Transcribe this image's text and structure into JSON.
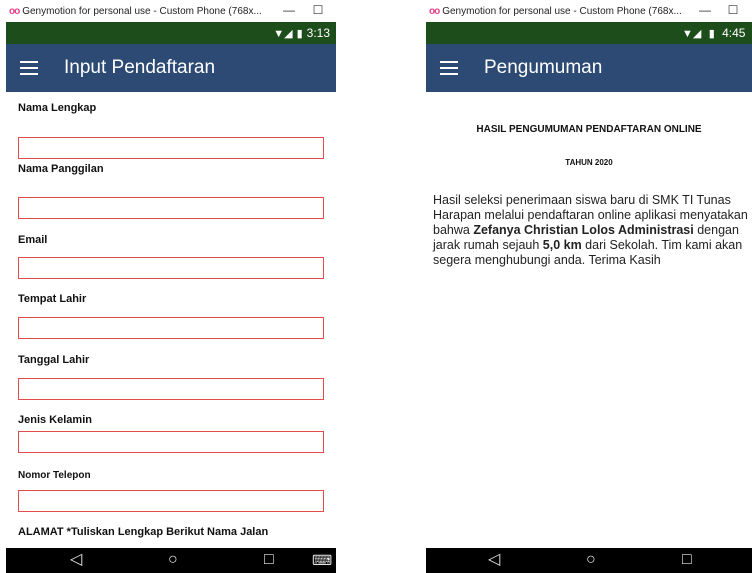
{
  "left": {
    "window_title": "Genymotion for personal use - Custom Phone (768x...",
    "logo": "oo",
    "minimize": "—",
    "maximize": "☐",
    "time": "3:13",
    "app_title": "Input Pendaftaran",
    "fields": [
      {
        "label": "Nama Lengkap"
      },
      {
        "label": "Nama Panggilan"
      },
      {
        "label": "Email"
      },
      {
        "label": "Tempat Lahir"
      },
      {
        "label": "Tanggal Lahir"
      },
      {
        "label": "Jenis Kelamin"
      },
      {
        "label": "Nomor Telepon"
      },
      {
        "label": "ALAMAT *Tuliskan Lengkap Berikut Nama Jalan"
      }
    ],
    "nav": {
      "back": "◁",
      "home": "○",
      "recent": "□",
      "keyboard": "⌨"
    }
  },
  "right": {
    "window_title": "Genymotion for personal use - Custom Phone (768x...",
    "logo": "oo",
    "minimize": "—",
    "maximize": "☐",
    "time": "4:45",
    "app_title": "Pengumuman",
    "heading": "HASIL PENGUMUMAN PENDAFTARAN ONLINE",
    "year": "TAHUN 2020",
    "body": {
      "part1": "Hasil seleksi penerimaan siswa baru di SMK TI Tunas Harapan melalui pendaftaran online aplikasi menyatakan bahwa ",
      "name": "Zefanya Christian Lolos Administrasi",
      "part2": " dengan jarak rumah sejauh ",
      "distance": "5,0 km",
      "part3": " dari Sekolah. Tim kami akan segera menghubungi anda. Terima Kasih"
    },
    "nav": {
      "back": "◁",
      "home": "○",
      "recent": "□"
    }
  },
  "colors": {
    "status_bar": "#1e4d1c",
    "app_bar": "#2c4a73",
    "input_border": "#e04b4b",
    "logo": "#e8408c"
  }
}
